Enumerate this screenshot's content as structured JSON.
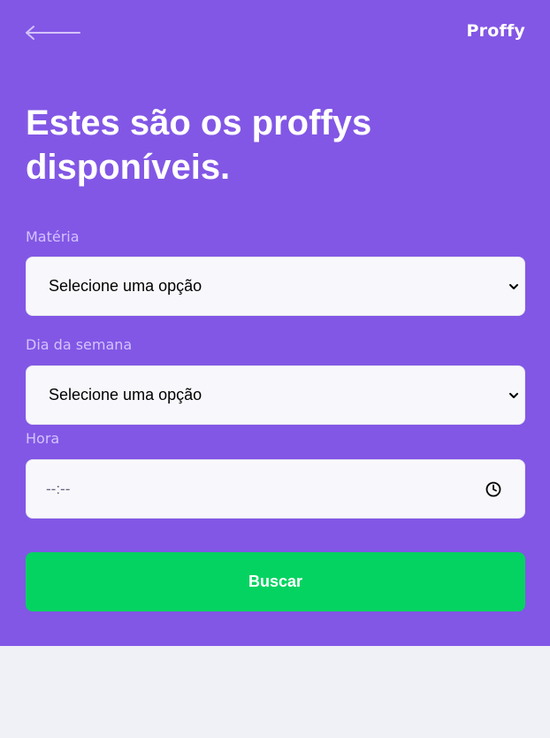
{
  "app": {
    "logo_text": "Proffy"
  },
  "page": {
    "title": "Estes são os proffys disponíveis."
  },
  "form": {
    "subject": {
      "label": "Matéria",
      "selected_value": "Selecione uma opção"
    },
    "weekday": {
      "label": "Dia da semana",
      "selected_value": "Selecione uma opção"
    },
    "time": {
      "label": "Hora",
      "value": "--:--"
    },
    "submit_label": "Buscar"
  },
  "colors": {
    "primary": "#8257E5",
    "background": "#F0F0F7",
    "label": "#D4C2FF",
    "input_bg": "#F8F8FC",
    "button": "#04D361",
    "white": "#FFFFFF"
  },
  "icons": {
    "back": "arrow-left-icon",
    "select": "chevron-down-icon",
    "time": "clock-icon"
  }
}
